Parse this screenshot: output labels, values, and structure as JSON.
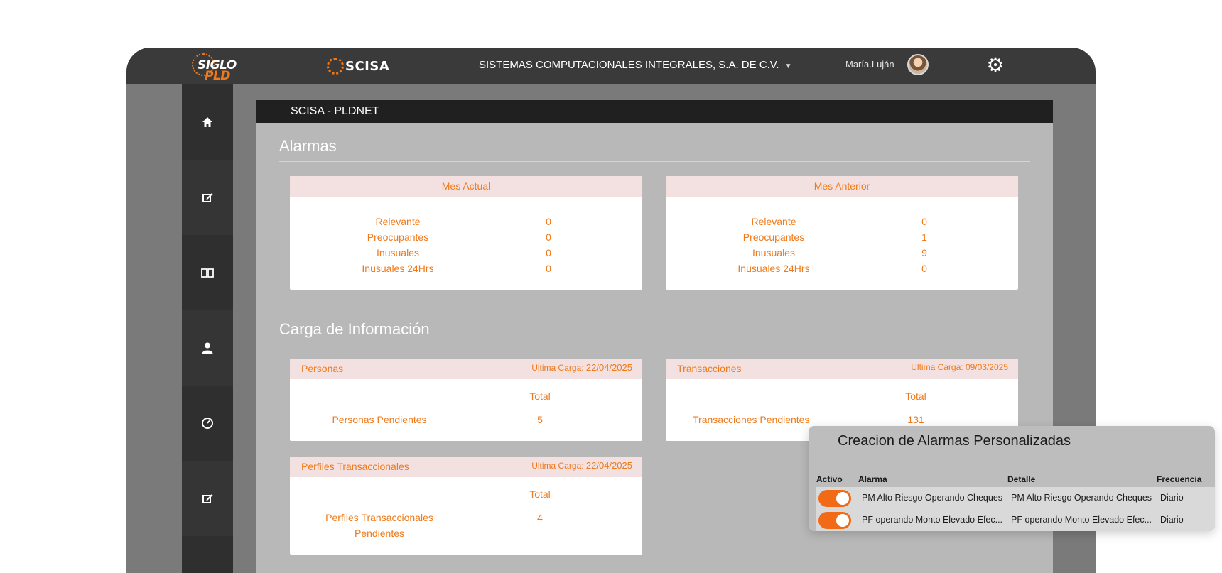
{
  "topbar": {
    "brand_top": "SIGLO",
    "brand_bottom": "PLD",
    "scisa_logo": "SCISA",
    "company": "SISTEMAS COMPUTACIONALES INTEGRALES, S.A. DE C.V.",
    "user": "María.Luján"
  },
  "sidebar": {
    "icons": [
      "home-icon",
      "edit-icon",
      "book-icon",
      "user-icon",
      "clock-icon",
      "edit-icon"
    ]
  },
  "panel": {
    "header": "SCISA - PLDNET",
    "alarmas_title": "Alarmas",
    "carga_title": "Carga de Información"
  },
  "mes_actual": {
    "title": "Mes Actual",
    "rows": [
      {
        "label": "Relevante",
        "value": "0"
      },
      {
        "label": "Preocupantes",
        "value": "0"
      },
      {
        "label": "Inusuales",
        "value": "0"
      },
      {
        "label": "Inusuales 24Hrs",
        "value": "0"
      }
    ]
  },
  "mes_anterior": {
    "title": "Mes Anterior",
    "rows": [
      {
        "label": "Relevante",
        "value": "0"
      },
      {
        "label": "Preocupantes",
        "value": "1"
      },
      {
        "label": "Inusuales",
        "value": "9"
      },
      {
        "label": "Inusuales 24Hrs",
        "value": "0"
      }
    ]
  },
  "personas": {
    "title": "Personas",
    "ultima_label": "Ultima Carga:",
    "ultima_date": "22/04/2025",
    "total_label": "Total",
    "row_label": "Personas Pendientes",
    "row_value": "5"
  },
  "transacciones": {
    "title": "Transacciones",
    "ultima": "Ultima Carga: 09/03/2025",
    "total_label": "Total",
    "row_label": "Transacciones Pendientes",
    "row_value": "131"
  },
  "perfiles": {
    "title": "Perfiles Transaccionales",
    "ultima_label": "Ultima Carga:",
    "ultima_date": "22/04/2025",
    "total_label": "Total",
    "row_label_1": "Perfiles Transaccionales",
    "row_label_2": "Pendientes",
    "row_value": "4"
  },
  "popup": {
    "title": "Creacion de Alarmas Personalizadas",
    "columns": {
      "activo": "Activo",
      "alarma": "Alarma",
      "detalle": "Detalle",
      "frecuencia": "Frecuencia"
    },
    "rows": [
      {
        "activo": true,
        "alarma": "PM Alto Riesgo Operando Cheques",
        "detalle": "PM Alto Riesgo Operando Cheques",
        "frecuencia": "Diario"
      },
      {
        "activo": true,
        "alarma": "PF operando Monto Elevado Efec...",
        "detalle": "PF operando Monto Elevado Efec...",
        "frecuencia": "Diario"
      }
    ]
  },
  "colors": {
    "accent": "#f07a1a",
    "toggle_on": "#f26a16",
    "card_header": "#f3e0e0"
  }
}
